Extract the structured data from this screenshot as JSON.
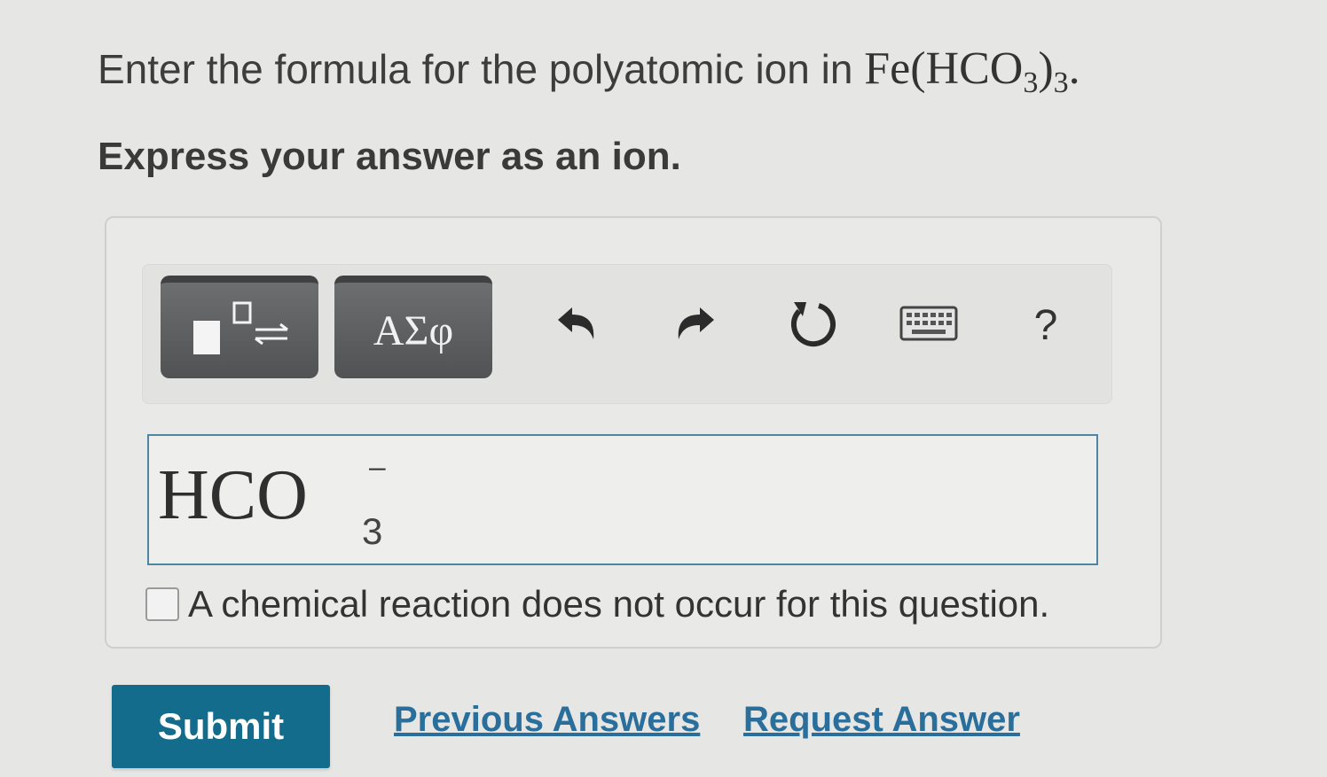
{
  "question": {
    "prompt_text": "Enter the formula for the polyatomic ion in",
    "formula_prefix": "Fe(HCO",
    "formula_inner_subscript": "3",
    "formula_close": ")",
    "formula_outer_subscript": "3",
    "formula_end": ".",
    "instruction": "Express your answer as an ion."
  },
  "toolbar": {
    "templates_icon": "templates-icon",
    "symbols_label": "ΑΣφ",
    "undo_icon": "undo-icon",
    "redo_icon": "redo-icon",
    "reset_icon": "reset-icon",
    "keyboard_icon": "keyboard-icon",
    "help_label": "?"
  },
  "answer": {
    "main_text": "HCO",
    "charge": "−",
    "subscript": "3"
  },
  "no_reaction": {
    "label": "A chemical reaction does not occur for this question.",
    "checked": false
  },
  "actions": {
    "submit_label": "Submit",
    "previous_answers_label": "Previous Answers",
    "request_answer_label": "Request Answer"
  },
  "colors": {
    "submit_bg": "#146c8d",
    "link": "#2a6f9c",
    "input_border": "#4d87a3"
  }
}
